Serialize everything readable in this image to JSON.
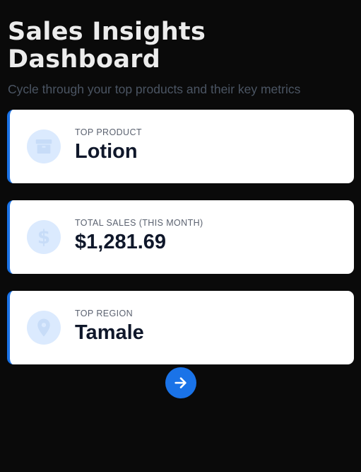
{
  "header": {
    "title_line1": "Sales Insights",
    "title_line2": "Dashboard",
    "subtitle": "Cycle through your top products and their key metrics"
  },
  "cards": [
    {
      "label": "TOP PRODUCT",
      "value": "Lotion",
      "icon": "box-icon"
    },
    {
      "label": "TOTAL SALES (THIS MONTH)",
      "value": "$1,281.69",
      "icon": "dollar-icon"
    },
    {
      "label": "TOP REGION",
      "value": "Tamale",
      "icon": "location-pin-icon"
    }
  ],
  "next_button": {
    "icon": "arrow-right-icon"
  },
  "colors": {
    "background": "#0a0a0a",
    "accent": "#1a73e8",
    "icon_circle": "#dbeafe",
    "icon_fill": "#c7dcf8"
  }
}
